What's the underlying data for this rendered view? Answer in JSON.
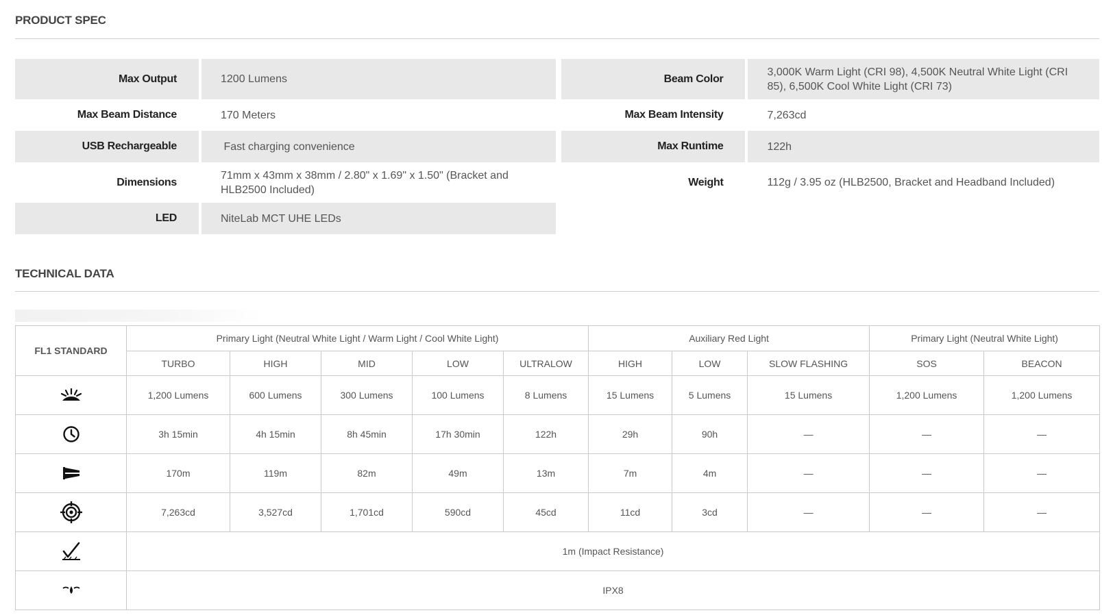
{
  "product_spec": {
    "title": "PRODUCT SPEC",
    "rows": [
      {
        "left": {
          "label": "Max Output",
          "value": "1200 Lumens"
        },
        "right": {
          "label": "Beam Color",
          "value": "3,000K Warm Light (CRI 98), 4,500K Neutral White Light (CRI 85), 6,500K Cool White Light (CRI 73)"
        }
      },
      {
        "left": {
          "label": "Max Beam Distance",
          "value": "170 Meters"
        },
        "right": {
          "label": "Max Beam Intensity",
          "value": "7,263cd"
        }
      },
      {
        "left": {
          "label": "USB Rechargeable",
          "value": " Fast charging convenience"
        },
        "right": {
          "label": "Max Runtime",
          "value": "122h"
        }
      },
      {
        "left": {
          "label": "Dimensions",
          "value": "71mm x 43mm x 38mm / 2.80\" x 1.69\" x 1.50\" (Bracket and HLB2500 Included)"
        },
        "right": {
          "label": "Weight",
          "value": "112g / 3.95 oz (HLB2500, Bracket and Headband Included)"
        }
      },
      {
        "left": {
          "label": "LED",
          "value": "NiteLab MCT UHE LEDs"
        }
      }
    ]
  },
  "technical_data": {
    "title": "TECHNICAL DATA",
    "standard_label": "FL1 STANDARD",
    "groups": [
      "Primary Light (Neutral White Light / Warm Light / Cool White Light)",
      "Auxiliary Red Light",
      "Primary Light (Neutral White Light)"
    ],
    "modes": [
      "TURBO",
      "HIGH",
      "MID",
      "LOW",
      "ULTRALOW",
      "HIGH",
      "LOW",
      "SLOW FLASHING",
      "SOS",
      "BEACON"
    ],
    "rows": {
      "output": [
        "1,200 Lumens",
        "600 Lumens",
        "300 Lumens",
        "100 Lumens",
        "8 Lumens",
        "15 Lumens",
        "5 Lumens",
        "15 Lumens",
        "1,200 Lumens",
        "1,200 Lumens"
      ],
      "runtime": [
        "3h 15min",
        "4h 15min",
        "8h 45min",
        "17h 30min",
        "122h",
        "29h",
        "90h",
        "—",
        "—",
        "—"
      ],
      "distance": [
        "170m",
        "119m",
        "82m",
        "49m",
        "13m",
        "7m",
        "4m",
        "—",
        "—",
        "—"
      ],
      "intensity": [
        "7,263cd",
        "3,527cd",
        "1,701cd",
        "590cd",
        "45cd",
        "11cd",
        "3cd",
        "—",
        "—",
        "—"
      ]
    },
    "impact": "1m (Impact Resistance)",
    "waterproof": "IPX8",
    "icons": [
      "output-icon",
      "runtime-clock-icon",
      "beam-distance-icon",
      "intensity-target-icon",
      "impact-resistance-icon",
      "waterproof-icon"
    ]
  }
}
